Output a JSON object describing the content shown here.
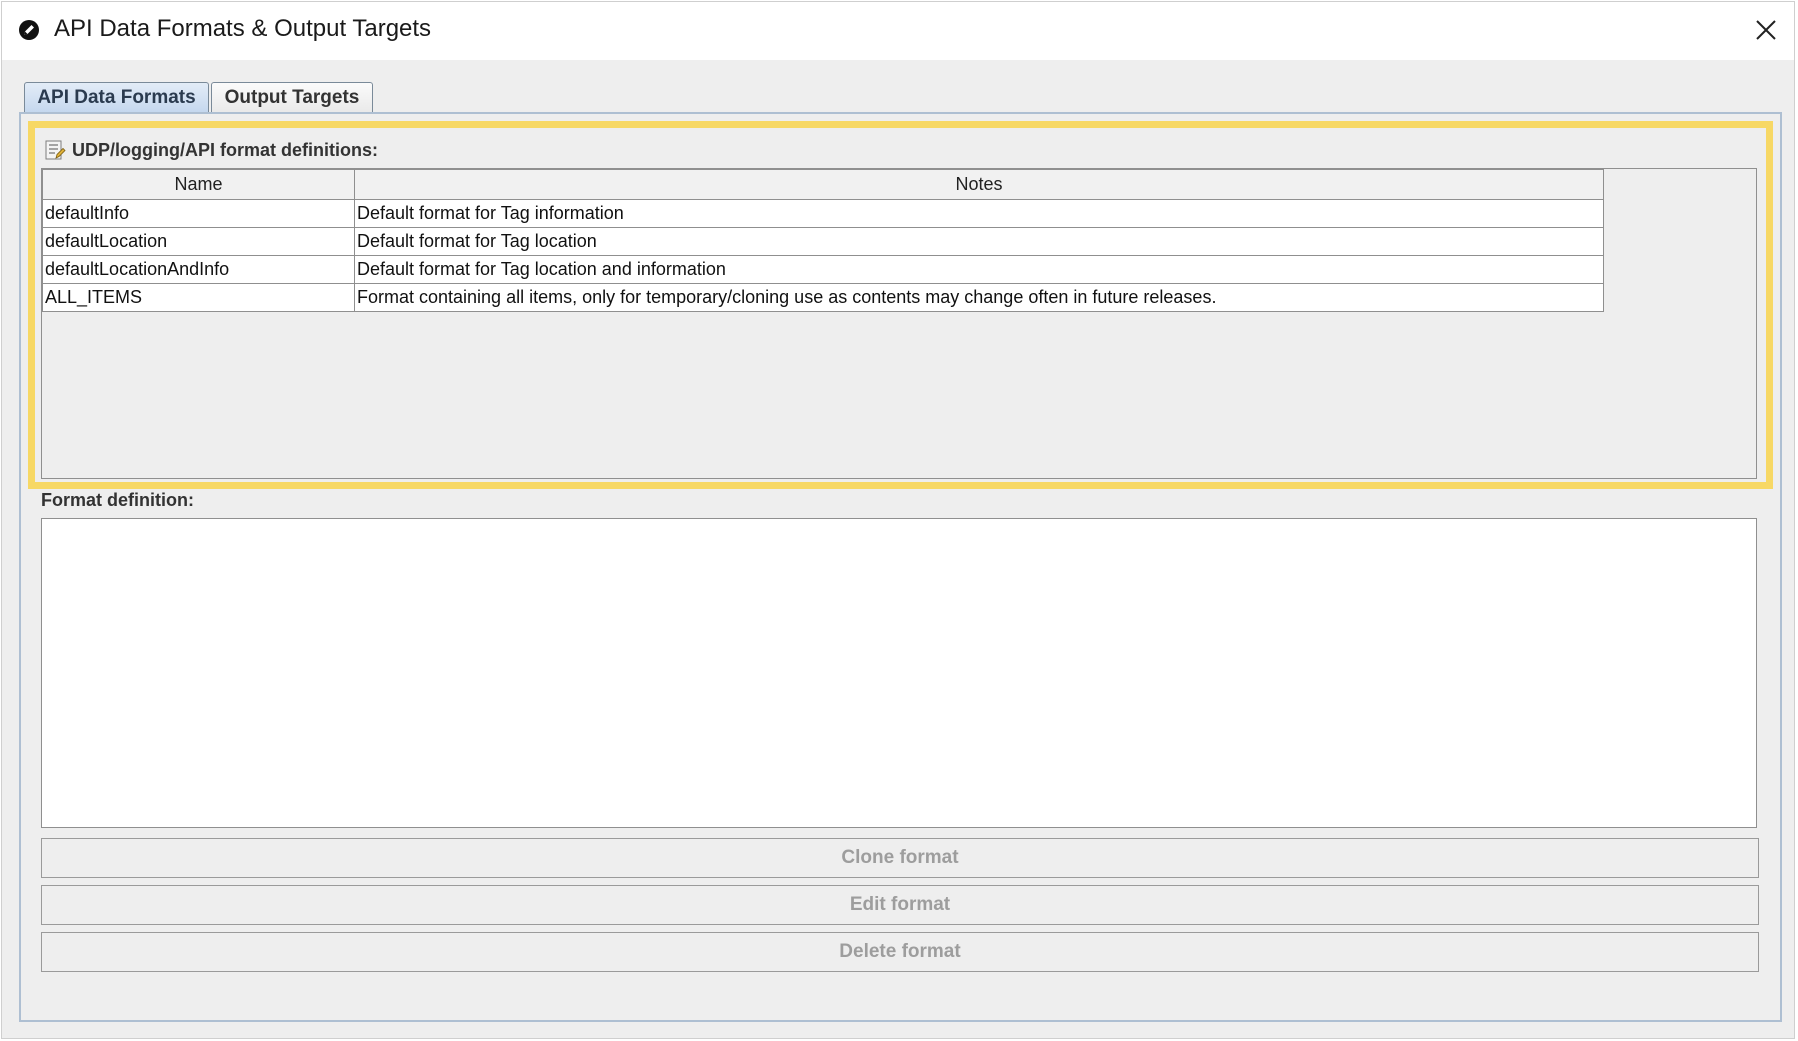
{
  "window": {
    "title": "API Data Formats & Output Targets",
    "icons": {
      "app": "edit-pencil-icon",
      "close": "close-icon"
    }
  },
  "tabs": [
    {
      "label": "API Data Formats",
      "active": true
    },
    {
      "label": "Output Targets",
      "active": false
    }
  ],
  "definitions": {
    "title": "UDP/logging/API format definitions:",
    "icon": "format-list-icon",
    "columns": [
      "Name",
      "Notes"
    ],
    "rows": [
      {
        "name": "defaultInfo",
        "notes": "Default format for Tag information"
      },
      {
        "name": "defaultLocation",
        "notes": "Default format for Tag location"
      },
      {
        "name": "defaultLocationAndInfo",
        "notes": "Default format for Tag location and information"
      },
      {
        "name": "ALL_ITEMS",
        "notes": "Format containing all items, only for temporary/cloning use as contents may change often in future releases."
      }
    ]
  },
  "format_definition": {
    "label": "Format definition:",
    "value": ""
  },
  "buttons": {
    "clone": "Clone format",
    "edit": "Edit format",
    "delete": "Delete format"
  },
  "colors": {
    "highlight": "#f7d865",
    "tab_active": "#c4d7ee",
    "panel_border": "#aebfd2",
    "disabled_text": "#9d9d9d"
  }
}
